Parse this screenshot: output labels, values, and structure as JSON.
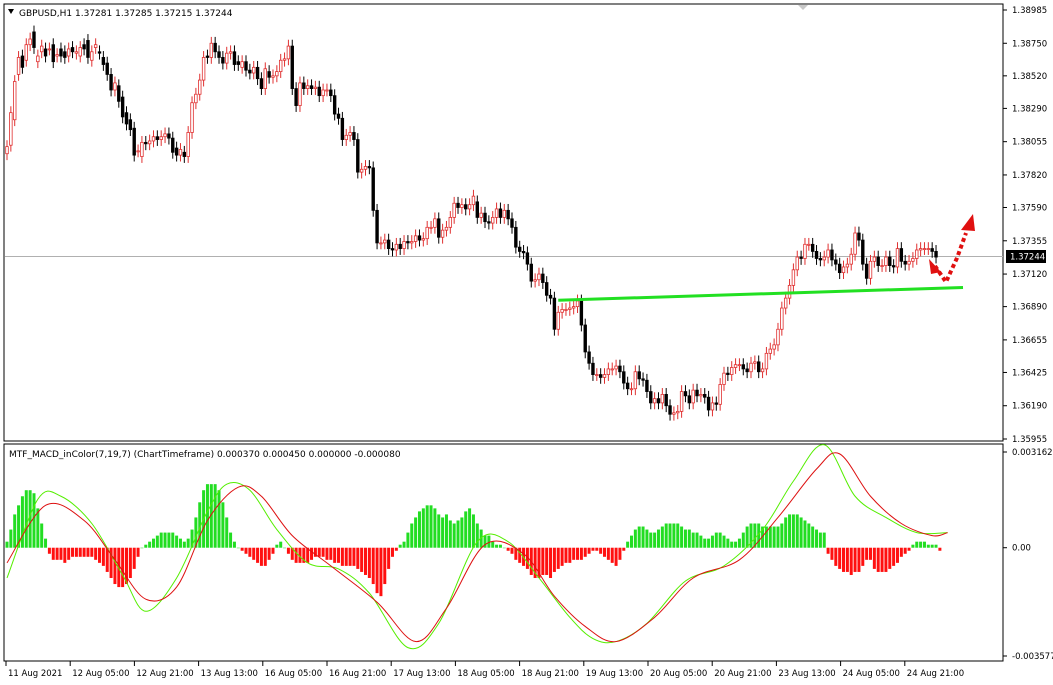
{
  "chart_data": [
    {
      "type": "candlestick",
      "title": "GBPUSD,H1  1.37281 1.37285 1.37215 1.37244",
      "symbol": "GBPUSD,H1",
      "ohlc_header": [
        "1.37281",
        "1.37285",
        "1.37215",
        "1.37244"
      ],
      "current_price": "1.37244",
      "ylim": [
        1.35955,
        1.38985
      ],
      "y_ticks": [
        "1.38985",
        "1.38750",
        "1.38520",
        "1.38290",
        "1.38055",
        "1.37820",
        "1.37590",
        "1.37355",
        "1.37120",
        "1.36890",
        "1.36655",
        "1.36425",
        "1.36190",
        "1.35955"
      ],
      "up_color": "#e03030",
      "down_color": "#000000",
      "trendline_color": "#22e022",
      "arrow_color": "#e01010",
      "trendline": {
        "start": {
          "bar": 143,
          "price": 1.36935
        },
        "end": {
          "bar": 248,
          "price": 1.37025
        }
      },
      "closes": [
        1.3802,
        1.3826,
        1.3848,
        1.3865,
        1.3858,
        1.3874,
        1.3878,
        1.3872,
        1.3866,
        1.3873,
        1.3866,
        1.3871,
        1.3862,
        1.3867,
        1.3866,
        1.3865,
        1.3871,
        1.3869,
        1.3869,
        1.3872,
        1.3871,
        1.3865,
        1.3869,
        1.3874,
        1.3868,
        1.386,
        1.3853,
        1.3842,
        1.3847,
        1.3834,
        1.3823,
        1.3818,
        1.3814,
        1.3796,
        1.3799,
        1.3805,
        1.3804,
        1.3806,
        1.3809,
        1.3807,
        1.3809,
        1.3811,
        1.3808,
        1.3798,
        1.3796,
        1.38,
        1.3795,
        1.3812,
        1.3833,
        1.3839,
        1.3849,
        1.3865,
        1.3865,
        1.3875,
        1.3869,
        1.3865,
        1.3861,
        1.3868,
        1.3869,
        1.386,
        1.386,
        1.3862,
        1.3856,
        1.3854,
        1.3858,
        1.385,
        1.3843,
        1.3857,
        1.3851,
        1.3852,
        1.3855,
        1.3863,
        1.3864,
        1.3873,
        1.3843,
        1.3831,
        1.3847,
        1.3843,
        1.3845,
        1.3843,
        1.3844,
        1.3838,
        1.3842,
        1.3842,
        1.3838,
        1.3825,
        1.3822,
        1.3807,
        1.381,
        1.3812,
        1.3807,
        1.3784,
        1.3786,
        1.3788,
        1.3787,
        1.3757,
        1.3734,
        1.3734,
        1.3736,
        1.373,
        1.3729,
        1.3733,
        1.373,
        1.3735,
        1.3734,
        1.3735,
        1.3739,
        1.3736,
        1.3737,
        1.3745,
        1.3745,
        1.3751,
        1.3738,
        1.3743,
        1.3745,
        1.3752,
        1.3762,
        1.3759,
        1.3761,
        1.3758,
        1.3761,
        1.3767,
        1.3752,
        1.3755,
        1.3749,
        1.3748,
        1.3752,
        1.3758,
        1.3752,
        1.3757,
        1.3751,
        1.3745,
        1.3731,
        1.3728,
        1.3727,
        1.3719,
        1.3707,
        1.3708,
        1.3712,
        1.3706,
        1.3697,
        1.3695,
        1.3673,
        1.3685,
        1.3687,
        1.3687,
        1.3688,
        1.3689,
        1.3693,
        1.3676,
        1.3657,
        1.3649,
        1.3641,
        1.3641,
        1.3639,
        1.3641,
        1.3645,
        1.3645,
        1.3647,
        1.3643,
        1.3635,
        1.3631,
        1.3631,
        1.3643,
        1.3638,
        1.3637,
        1.3629,
        1.3621,
        1.3624,
        1.3621,
        1.3627,
        1.3619,
        1.3613,
        1.3614,
        1.3615,
        1.3629,
        1.3626,
        1.3621,
        1.363,
        1.3626,
        1.3627,
        1.3625,
        1.3616,
        1.3621,
        1.362,
        1.3634,
        1.3642,
        1.3641,
        1.3646,
        1.3648,
        1.3648,
        1.3645,
        1.3643,
        1.3649,
        1.365,
        1.3643,
        1.3645,
        1.3656,
        1.3659,
        1.3662,
        1.3673,
        1.3688,
        1.3695,
        1.3704,
        1.3715,
        1.3724,
        1.3723,
        1.3733,
        1.3733,
        1.3728,
        1.3723,
        1.3722,
        1.3724,
        1.3729,
        1.3722,
        1.3719,
        1.3713,
        1.3717,
        1.3719,
        1.3726,
        1.3741,
        1.3736,
        1.3719,
        1.3709,
        1.3721,
        1.3724,
        1.3718,
        1.3718,
        1.3724,
        1.3718,
        1.3717,
        1.373,
        1.3721,
        1.3719,
        1.3721,
        1.3723,
        1.3729,
        1.373,
        1.373,
        1.373,
        1.3728,
        1.3724
      ],
      "opens": [
        1.3797,
        1.3803,
        1.3821,
        1.3853,
        1.3866,
        1.3863,
        1.3874,
        1.3883,
        1.3862,
        1.3869,
        1.3871,
        1.3871,
        1.3874,
        1.3866,
        1.3871,
        1.3869,
        1.3866,
        1.3872,
        1.3868,
        1.3866,
        1.3874,
        1.3877,
        1.3863,
        1.3872,
        1.3869,
        1.3865,
        1.3861,
        1.3853,
        1.3842,
        1.3845,
        1.3837,
        1.3826,
        1.3821,
        1.3815,
        1.3799,
        1.3795,
        1.3805,
        1.3804,
        1.3806,
        1.3809,
        1.3807,
        1.3809,
        1.3811,
        1.3808,
        1.3801,
        1.3796,
        1.3798,
        1.3795,
        1.3812,
        1.3833,
        1.3839,
        1.3849,
        1.3866,
        1.3865,
        1.3875,
        1.3869,
        1.3865,
        1.3861,
        1.3868,
        1.3869,
        1.3862,
        1.3858,
        1.3862,
        1.3856,
        1.3854,
        1.3858,
        1.385,
        1.3843,
        1.3855,
        1.3851,
        1.3852,
        1.3855,
        1.3863,
        1.3864,
        1.3873,
        1.3843,
        1.3831,
        1.3847,
        1.3843,
        1.3845,
        1.3843,
        1.3844,
        1.3838,
        1.3842,
        1.3842,
        1.3838,
        1.3825,
        1.3822,
        1.3807,
        1.381,
        1.3812,
        1.3807,
        1.3784,
        1.3786,
        1.3788,
        1.3787,
        1.3757,
        1.3734,
        1.3734,
        1.3736,
        1.373,
        1.3729,
        1.3733,
        1.373,
        1.3735,
        1.3734,
        1.3735,
        1.3739,
        1.3736,
        1.3737,
        1.3745,
        1.3745,
        1.3751,
        1.3738,
        1.3743,
        1.3745,
        1.3752,
        1.3762,
        1.3759,
        1.3761,
        1.3758,
        1.3761,
        1.3763,
        1.3752,
        1.3755,
        1.3749,
        1.3748,
        1.3752,
        1.3758,
        1.3752,
        1.3757,
        1.3751,
        1.3745,
        1.3731,
        1.3728,
        1.3727,
        1.3719,
        1.3707,
        1.3708,
        1.3712,
        1.3706,
        1.3697,
        1.3695,
        1.3673,
        1.3685,
        1.3687,
        1.3687,
        1.3688,
        1.3689,
        1.3693,
        1.3676,
        1.3657,
        1.3649,
        1.3641,
        1.3641,
        1.3639,
        1.3641,
        1.3645,
        1.3645,
        1.3647,
        1.3643,
        1.3635,
        1.3631,
        1.3631,
        1.3643,
        1.3638,
        1.3637,
        1.3629,
        1.3621,
        1.3624,
        1.3621,
        1.3627,
        1.3619,
        1.3613,
        1.3614,
        1.3615,
        1.3629,
        1.3626,
        1.3621,
        1.363,
        1.3626,
        1.3627,
        1.3625,
        1.3616,
        1.3621,
        1.362,
        1.3634,
        1.3642,
        1.3641,
        1.3646,
        1.3648,
        1.3648,
        1.3645,
        1.3643,
        1.3649,
        1.365,
        1.3643,
        1.3645,
        1.3656,
        1.3659,
        1.3662,
        1.3673,
        1.3688,
        1.3695,
        1.3704,
        1.3715,
        1.3724,
        1.3723,
        1.3733,
        1.3733,
        1.3728,
        1.3723,
        1.3722,
        1.3724,
        1.3729,
        1.3722,
        1.3719,
        1.3713,
        1.3717,
        1.3719,
        1.3726,
        1.3741,
        1.3736,
        1.3719,
        1.3709,
        1.3721,
        1.3724,
        1.3718,
        1.3718,
        1.3724,
        1.3718,
        1.3717,
        1.373,
        1.3721,
        1.3719,
        1.3721,
        1.3723,
        1.3729,
        1.373,
        1.373,
        1.373,
        1.3728
      ]
    },
    {
      "type": "macd",
      "title": "MTF_MACD_inColor(7,19,7) (ChartTimeframe) 0.000370 0.000450 0.000000 -0.000080",
      "indicator_label": "MTF_MACD_inColor(7,19,7) (ChartTimeframe) 0.000370 0.000450 0.000000 -0.000080",
      "ylim": [
        -0.003577,
        0.003162
      ],
      "y_ticks": [
        "0.003162",
        "0.00",
        "-0.003577"
      ],
      "positive_color": "#22dd22",
      "negative_color": "#ff1010",
      "macd_line_color": "#55ee00",
      "signal_line_color": "#dd1010",
      "histogram": [
        0.0002,
        0.0006,
        0.0011,
        0.0014,
        0.0017,
        0.0019,
        0.0019,
        0.0018,
        0.0013,
        0.0008,
        0.0003,
        -0.0002,
        -0.0004,
        -0.0004,
        -0.0004,
        -0.0005,
        -0.0004,
        -0.0003,
        -0.0003,
        -0.0003,
        -0.0003,
        -0.0003,
        -0.0003,
        -0.0004,
        -0.0005,
        -0.0006,
        -0.0008,
        -0.001,
        -0.0012,
        -0.0013,
        -0.0013,
        -0.0012,
        -0.001,
        -0.0007,
        -0.0003,
        0.0,
        0.0001,
        0.0002,
        0.0003,
        0.0004,
        0.0005,
        0.0005,
        0.0005,
        0.0005,
        0.0004,
        0.0003,
        0.0002,
        0.0003,
        0.0006,
        0.001,
        0.0015,
        0.0019,
        0.0021,
        0.0021,
        0.0021,
        0.0019,
        0.0015,
        0.001,
        0.0005,
        0.0002,
        0.0,
        -0.0001,
        -0.0002,
        -0.0003,
        -0.0004,
        -0.0005,
        -0.0006,
        -0.0006,
        -0.0004,
        -0.0002,
        0.0001,
        0.0002,
        0.0,
        -0.0002,
        -0.0004,
        -0.0005,
        -0.0005,
        -0.0005,
        -0.0005,
        -0.0004,
        -0.0003,
        -0.0003,
        -0.0003,
        -0.0004,
        -0.0004,
        -0.0005,
        -0.0005,
        -0.0006,
        -0.0006,
        -0.0006,
        -0.0006,
        -0.0007,
        -0.0008,
        -0.0009,
        -0.001,
        -0.0012,
        -0.0015,
        -0.0016,
        -0.0012,
        -0.0007,
        -0.0003,
        -0.0001,
        0.0001,
        0.0002,
        0.0005,
        0.0008,
        0.001,
        0.0012,
        0.0013,
        0.0014,
        0.0014,
        0.0013,
        0.0011,
        0.001,
        0.0011,
        0.0009,
        0.0008,
        0.0009,
        0.001,
        0.0012,
        0.0013,
        0.0011,
        0.0008,
        0.0006,
        0.0004,
        0.0004,
        0.0002,
        0.0001,
        0.0001,
        0.0,
        -0.0001,
        -0.0002,
        -0.0004,
        -0.0005,
        -0.0006,
        -0.0007,
        -0.0009,
        -0.001,
        -0.001,
        -0.0009,
        -0.0009,
        -0.001,
        -0.0008,
        -0.0007,
        -0.0006,
        -0.0005,
        -0.0005,
        -0.0004,
        -0.0004,
        -0.0004,
        -0.0003,
        -0.0002,
        -0.0001,
        -0.0001,
        -0.0002,
        -0.0003,
        -0.0004,
        -0.0005,
        -0.0006,
        -0.0004,
        -0.0001,
        0.0002,
        0.0004,
        0.0006,
        0.0007,
        0.0007,
        0.0006,
        0.0005,
        0.0005,
        0.0006,
        0.0007,
        0.0008,
        0.0008,
        0.0008,
        0.0008,
        0.0007,
        0.0006,
        0.0006,
        0.0005,
        0.0005,
        0.0004,
        0.0003,
        0.0003,
        0.0004,
        0.0005,
        0.0005,
        0.0004,
        0.0003,
        0.0002,
        0.0002,
        0.0003,
        0.0005,
        0.0007,
        0.0008,
        0.0008,
        0.0008,
        0.0007,
        0.0007,
        0.0007,
        0.0007,
        0.0007,
        0.0008,
        0.001,
        0.0011,
        0.0011,
        0.0011,
        0.001,
        0.0009,
        0.0008,
        0.0007,
        0.0006,
        0.0005,
        0.0005,
        -0.0002,
        -0.0004,
        -0.0006,
        -0.0007,
        -0.0008,
        -0.0008,
        -0.0009,
        -0.0008,
        -0.0008,
        -0.0006,
        -0.0004,
        -0.0004,
        -0.0007,
        -0.0008,
        -0.0008,
        -0.0008,
        -0.0007,
        -0.0006,
        -0.0005,
        -0.0003,
        -0.0002,
        -0.0001,
        0.0001,
        0.0002,
        0.0002,
        0.0002,
        0.0001,
        0.0001,
        0.0001,
        -0.0001
      ],
      "macd_line_key_points": [
        [
          0,
          -0.001
        ],
        [
          8,
          0.0016
        ],
        [
          14,
          0.0017
        ],
        [
          22,
          0.0008
        ],
        [
          30,
          -0.0009
        ],
        [
          36,
          -0.0021
        ],
        [
          44,
          -0.001
        ],
        [
          52,
          0.0012
        ],
        [
          57,
          0.0021
        ],
        [
          63,
          0.0019
        ],
        [
          70,
          0.0006
        ],
        [
          78,
          -0.0005
        ],
        [
          86,
          -0.0007
        ],
        [
          94,
          -0.0015
        ],
        [
          104,
          -0.0033
        ],
        [
          112,
          -0.0025
        ],
        [
          122,
          0.0002
        ],
        [
          130,
          0.0002
        ],
        [
          138,
          -0.001
        ],
        [
          146,
          -0.0023
        ],
        [
          152,
          -0.003
        ],
        [
          158,
          -0.0031
        ],
        [
          166,
          -0.0025
        ],
        [
          176,
          -0.0011
        ],
        [
          186,
          -0.0006
        ],
        [
          196,
          0.0006
        ],
        [
          204,
          0.0022
        ],
        [
          212,
          0.0034
        ],
        [
          220,
          0.0017
        ],
        [
          228,
          0.001
        ],
        [
          236,
          0.0005
        ],
        [
          244,
          0.0005
        ]
      ],
      "signal_line_key_points": [
        [
          0,
          -0.0005
        ],
        [
          10,
          0.0014
        ],
        [
          20,
          0.0009
        ],
        [
          28,
          -0.0004
        ],
        [
          36,
          -0.0017
        ],
        [
          44,
          -0.0013
        ],
        [
          52,
          0.0009
        ],
        [
          60,
          0.002
        ],
        [
          66,
          0.0017
        ],
        [
          74,
          0.0004
        ],
        [
          84,
          -0.0006
        ],
        [
          96,
          -0.0018
        ],
        [
          106,
          -0.0031
        ],
        [
          114,
          -0.002
        ],
        [
          124,
          0.0001
        ],
        [
          134,
          -0.0002
        ],
        [
          142,
          -0.0016
        ],
        [
          150,
          -0.0026
        ],
        [
          158,
          -0.0031
        ],
        [
          168,
          -0.0023
        ],
        [
          178,
          -0.001
        ],
        [
          190,
          -0.0004
        ],
        [
          200,
          0.001
        ],
        [
          210,
          0.0026
        ],
        [
          216,
          0.0031
        ],
        [
          224,
          0.0017
        ],
        [
          232,
          0.0008
        ],
        [
          240,
          0.0004
        ],
        [
          244,
          0.0005
        ]
      ]
    }
  ],
  "x_axis_labels": [
    "11 Aug 2021",
    "12 Aug 05:00",
    "12 Aug 21:00",
    "13 Aug 13:00",
    "16 Aug 05:00",
    "16 Aug 21:00",
    "17 Aug 13:00",
    "18 Aug 05:00",
    "18 Aug 21:00",
    "19 Aug 13:00",
    "20 Aug 05:00",
    "20 Aug 21:00",
    "23 Aug 13:00",
    "24 Aug 05:00",
    "24 Aug 21:00"
  ]
}
